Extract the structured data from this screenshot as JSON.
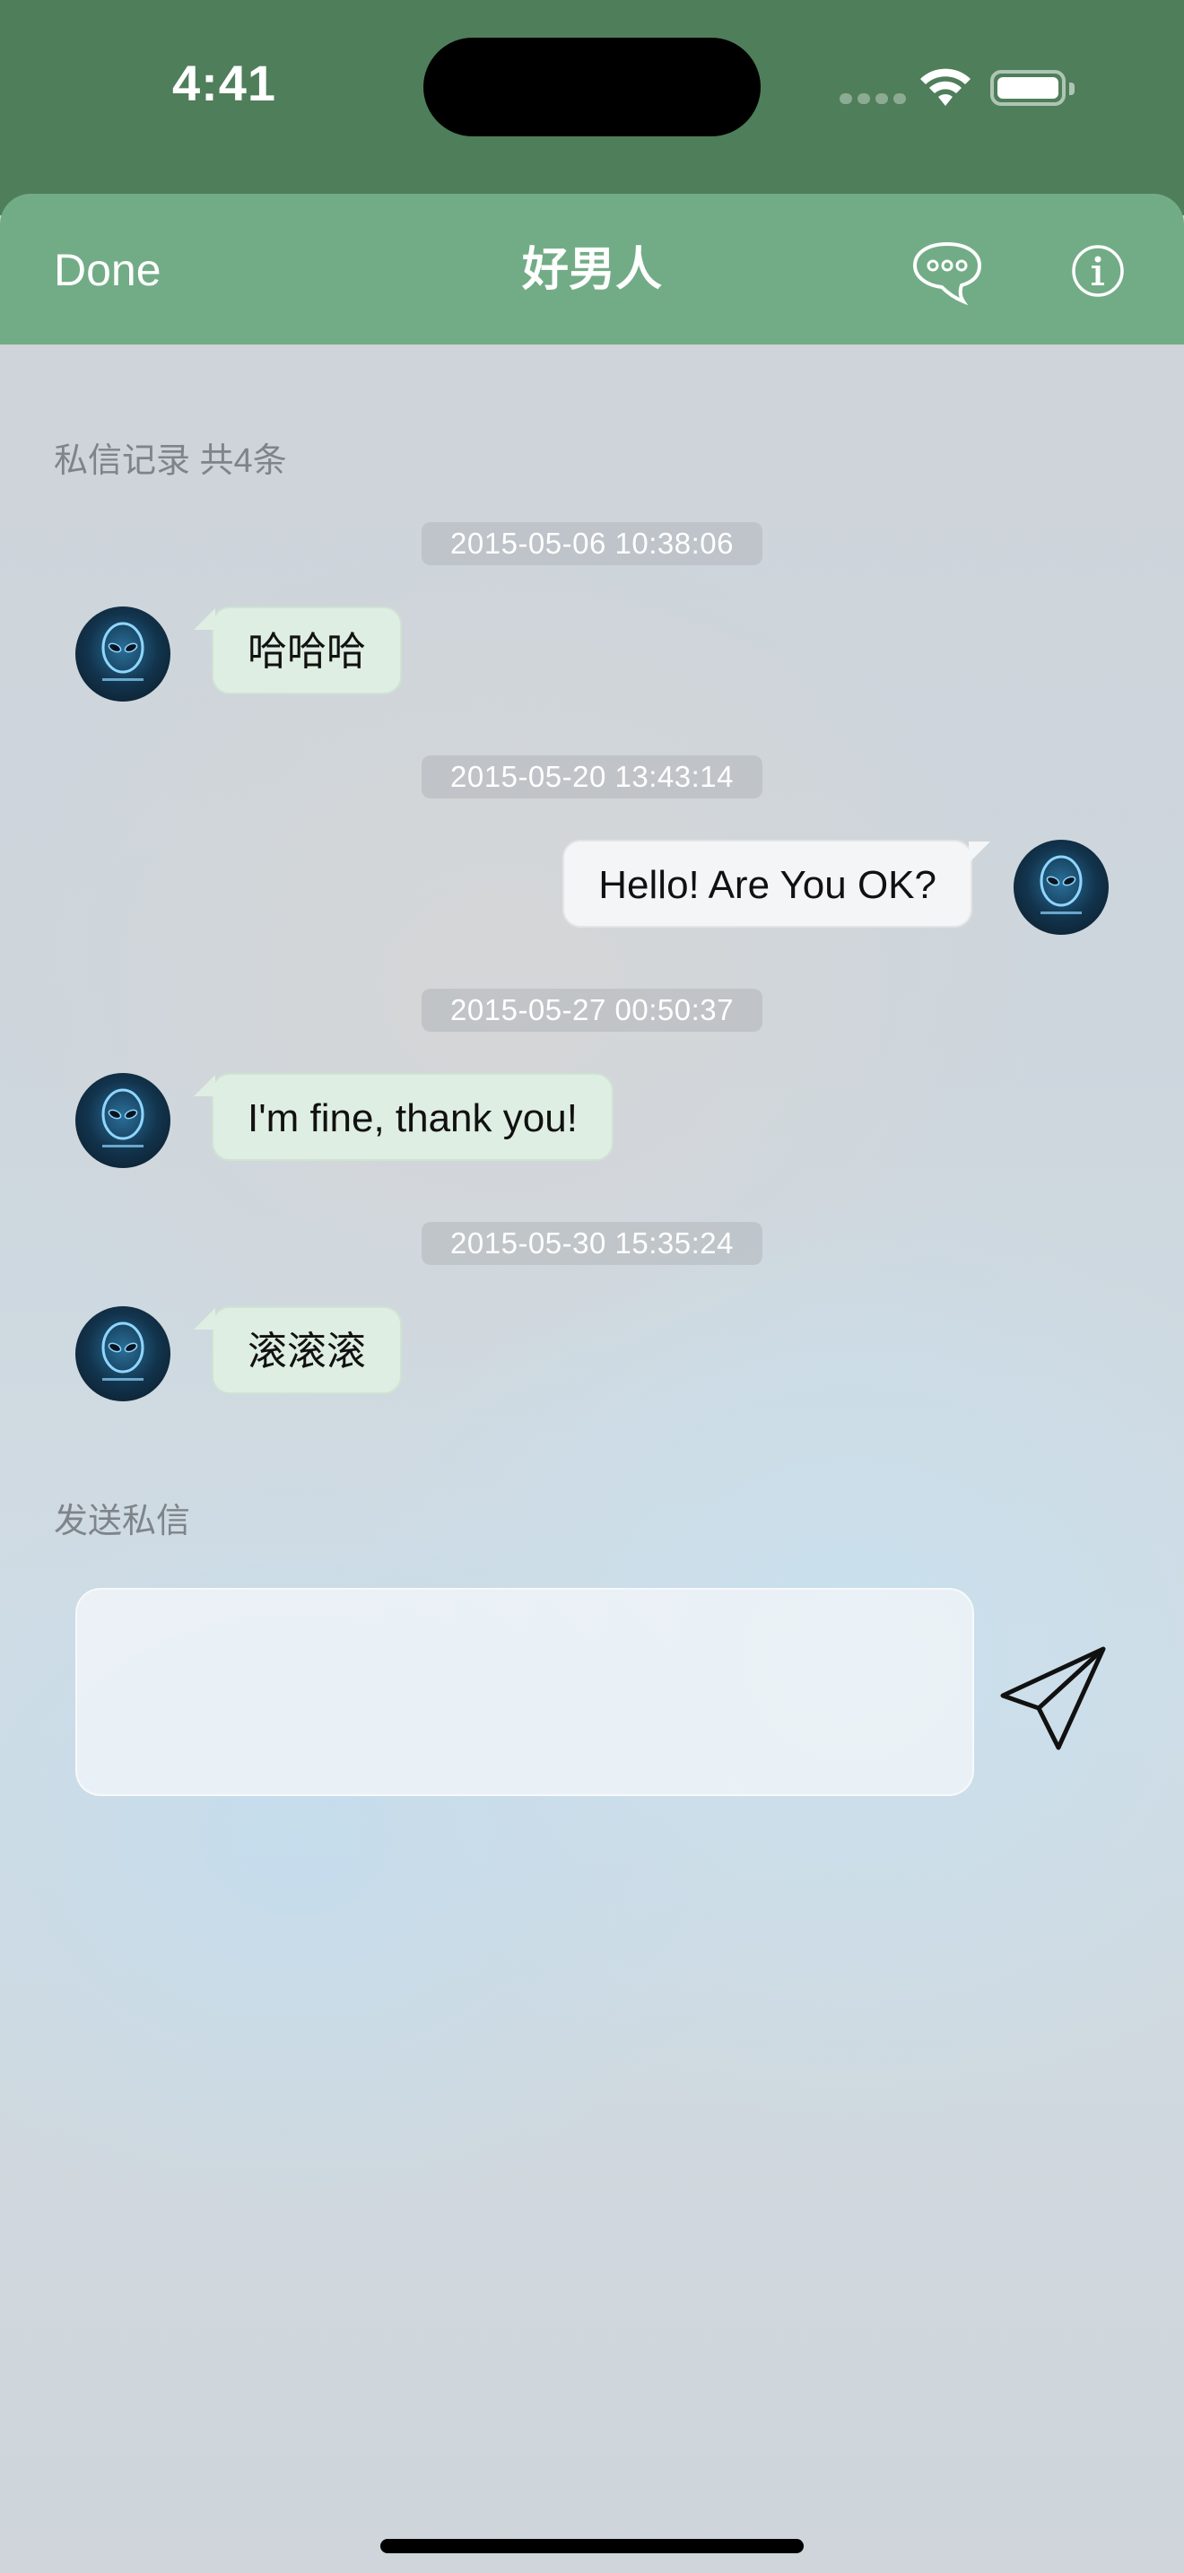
{
  "status_bar": {
    "time": "4:41"
  },
  "nav": {
    "done_label": "Done",
    "title": "好男人",
    "chat_icon": "chat-bubble-ellipsis-icon",
    "info_icon": "info-circle-icon"
  },
  "history": {
    "header": "私信记录 共4条",
    "messages": [
      {
        "time": "2015-05-06 10:38:06",
        "text": "哈哈哈",
        "direction": "incoming"
      },
      {
        "time": "2015-05-20 13:43:14",
        "text": "Hello! Are You OK?",
        "direction": "outgoing"
      },
      {
        "time": "2015-05-27 00:50:37",
        "text": "I'm fine, thank you!",
        "direction": "incoming"
      },
      {
        "time": "2015-05-30 15:35:24",
        "text": "滚滚滚",
        "direction": "incoming"
      }
    ]
  },
  "compose": {
    "header": "发送私信",
    "input_value": "",
    "send_icon": "paper-plane-icon"
  },
  "colors": {
    "nav_green": "#72ac86",
    "incoming_bubble": "#dfeee2",
    "outgoing_bubble": "#f4f5f6"
  }
}
